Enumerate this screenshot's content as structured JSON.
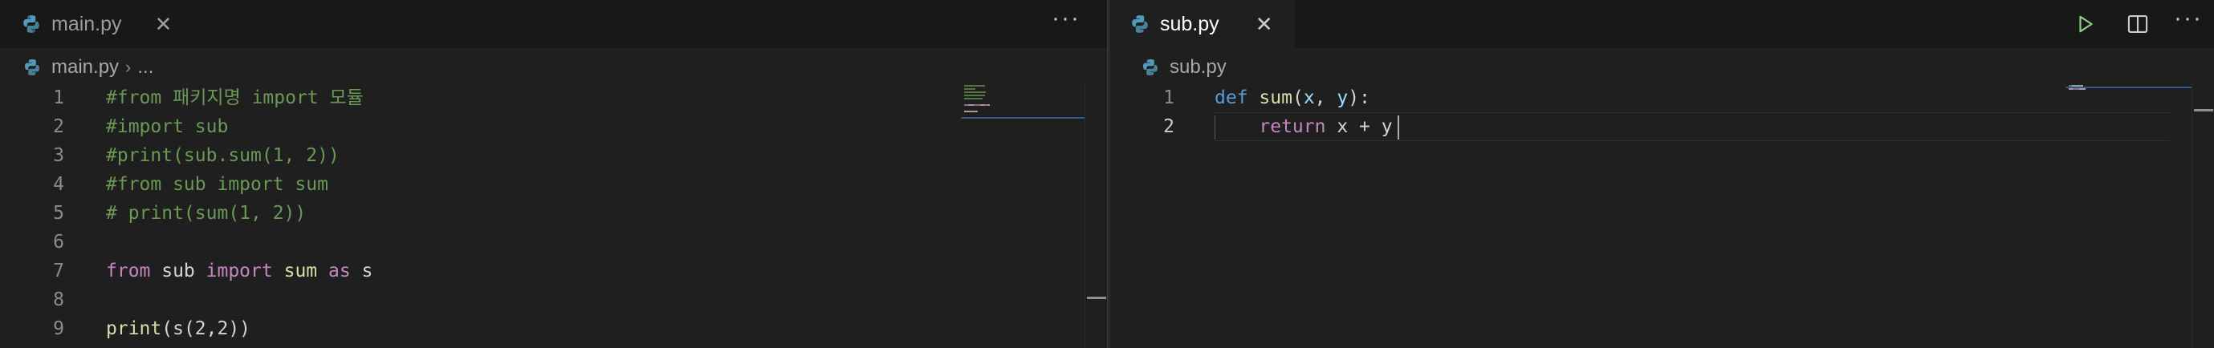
{
  "left": {
    "tab": {
      "label": "main.py",
      "close": "✕"
    },
    "more": "···",
    "breadcrumb": {
      "file": "main.py",
      "sep": "›",
      "more": "..."
    },
    "lines": [
      {
        "n": "1",
        "tokens": [
          {
            "t": "#from 패키지명 import 모듈",
            "c": "comment"
          }
        ]
      },
      {
        "n": "2",
        "tokens": [
          {
            "t": "#import sub",
            "c": "comment"
          }
        ]
      },
      {
        "n": "3",
        "tokens": [
          {
            "t": "#print(sub.sum(1, 2))",
            "c": "comment"
          }
        ]
      },
      {
        "n": "4",
        "tokens": [
          {
            "t": "#from sub import sum",
            "c": "comment"
          }
        ]
      },
      {
        "n": "5",
        "tokens": [
          {
            "t": "# print(sum(1, 2))",
            "c": "comment"
          }
        ]
      },
      {
        "n": "6",
        "tokens": []
      },
      {
        "n": "7",
        "tokens": [
          {
            "t": "from",
            "c": "kw"
          },
          {
            "t": " sub ",
            "c": "plain"
          },
          {
            "t": "import",
            "c": "kw"
          },
          {
            "t": " ",
            "c": "plain"
          },
          {
            "t": "sum",
            "c": "fn"
          },
          {
            "t": " ",
            "c": "plain"
          },
          {
            "t": "as",
            "c": "kw"
          },
          {
            "t": " s",
            "c": "plain"
          }
        ]
      },
      {
        "n": "8",
        "tokens": []
      },
      {
        "n": "9",
        "tokens": [
          {
            "t": "print",
            "c": "fn"
          },
          {
            "t": "(s(2,2))",
            "c": "plain"
          }
        ]
      }
    ]
  },
  "right": {
    "tab": {
      "label": "sub.py",
      "close": "✕"
    },
    "run": "▷",
    "split": "split",
    "more": "···",
    "breadcrumb": {
      "file": "sub.py"
    },
    "lines": [
      {
        "n": "1",
        "tokens": [
          {
            "t": "def",
            "c": "def"
          },
          {
            "t": " ",
            "c": "plain"
          },
          {
            "t": "sum",
            "c": "fn"
          },
          {
            "t": "(",
            "c": "plain"
          },
          {
            "t": "x",
            "c": "var"
          },
          {
            "t": ", ",
            "c": "plain"
          },
          {
            "t": "y",
            "c": "var"
          },
          {
            "t": "):",
            "c": "plain"
          }
        ]
      },
      {
        "n": "2",
        "tokens": [
          {
            "t": "    ",
            "c": "plain"
          },
          {
            "t": "return",
            "c": "kw"
          },
          {
            "t": " x + y",
            "c": "plain"
          }
        ]
      }
    ]
  },
  "colors": {
    "comment": "#6a9955",
    "kw": "#c586c0",
    "def": "#569cd6",
    "fn": "#dcdcaa",
    "var": "#9cdcfe",
    "plain": "#d4d4d4",
    "run": "#89d185"
  },
  "icons": {
    "file": "python-icon",
    "close": "close-icon",
    "more": "more-actions-icon",
    "run": "run-icon",
    "split": "split-editor-icon"
  }
}
